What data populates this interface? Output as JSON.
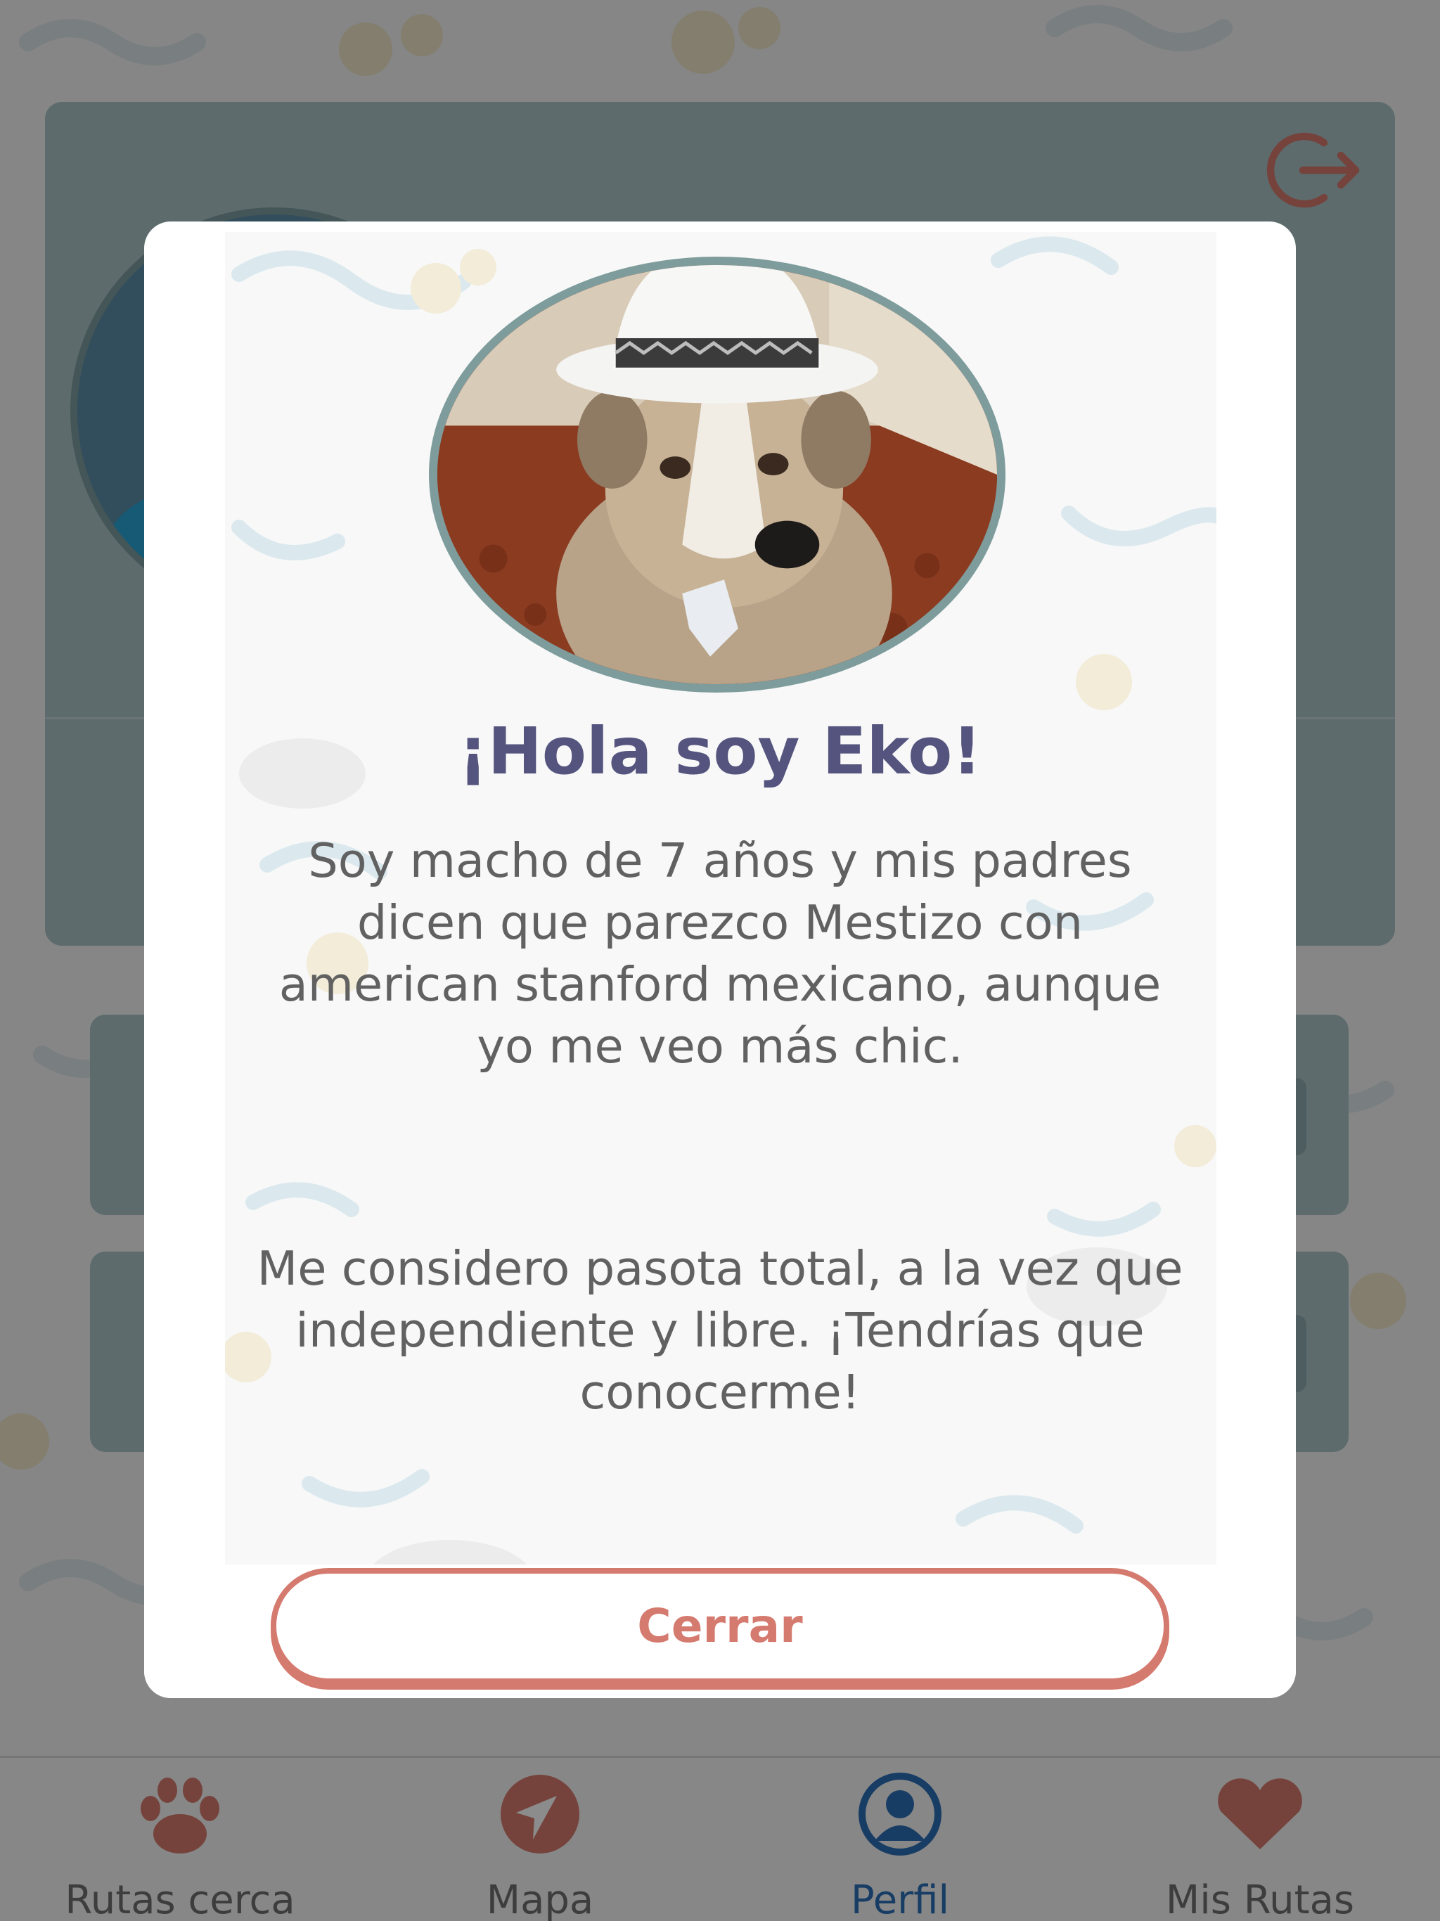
{
  "modal": {
    "title": "¡Hola soy Eko!",
    "paragraph_1": "Soy macho de 7 años y mis padres dicen que parezco Mestizo con american stanford mexicano, aunque yo me veo más chic.",
    "paragraph_2": "Me considero pasota total, a la vez que independiente y libre. ¡Tendrías que conocerme!",
    "close_label": "Cerrar"
  },
  "tabbar": {
    "tabs": [
      {
        "label": "Rutas cerca",
        "icon": "paw-icon"
      },
      {
        "label": "Mapa",
        "icon": "navigation-arrow-icon"
      },
      {
        "label": "Perfil",
        "icon": "user-icon",
        "active": true
      },
      {
        "label": "Mis Rutas",
        "icon": "heart-icon"
      }
    ]
  },
  "colors": {
    "accent": "#d57a6e",
    "title": "#54547e",
    "active_tab": "#2c6fb8",
    "card": "#a9c3c7"
  }
}
